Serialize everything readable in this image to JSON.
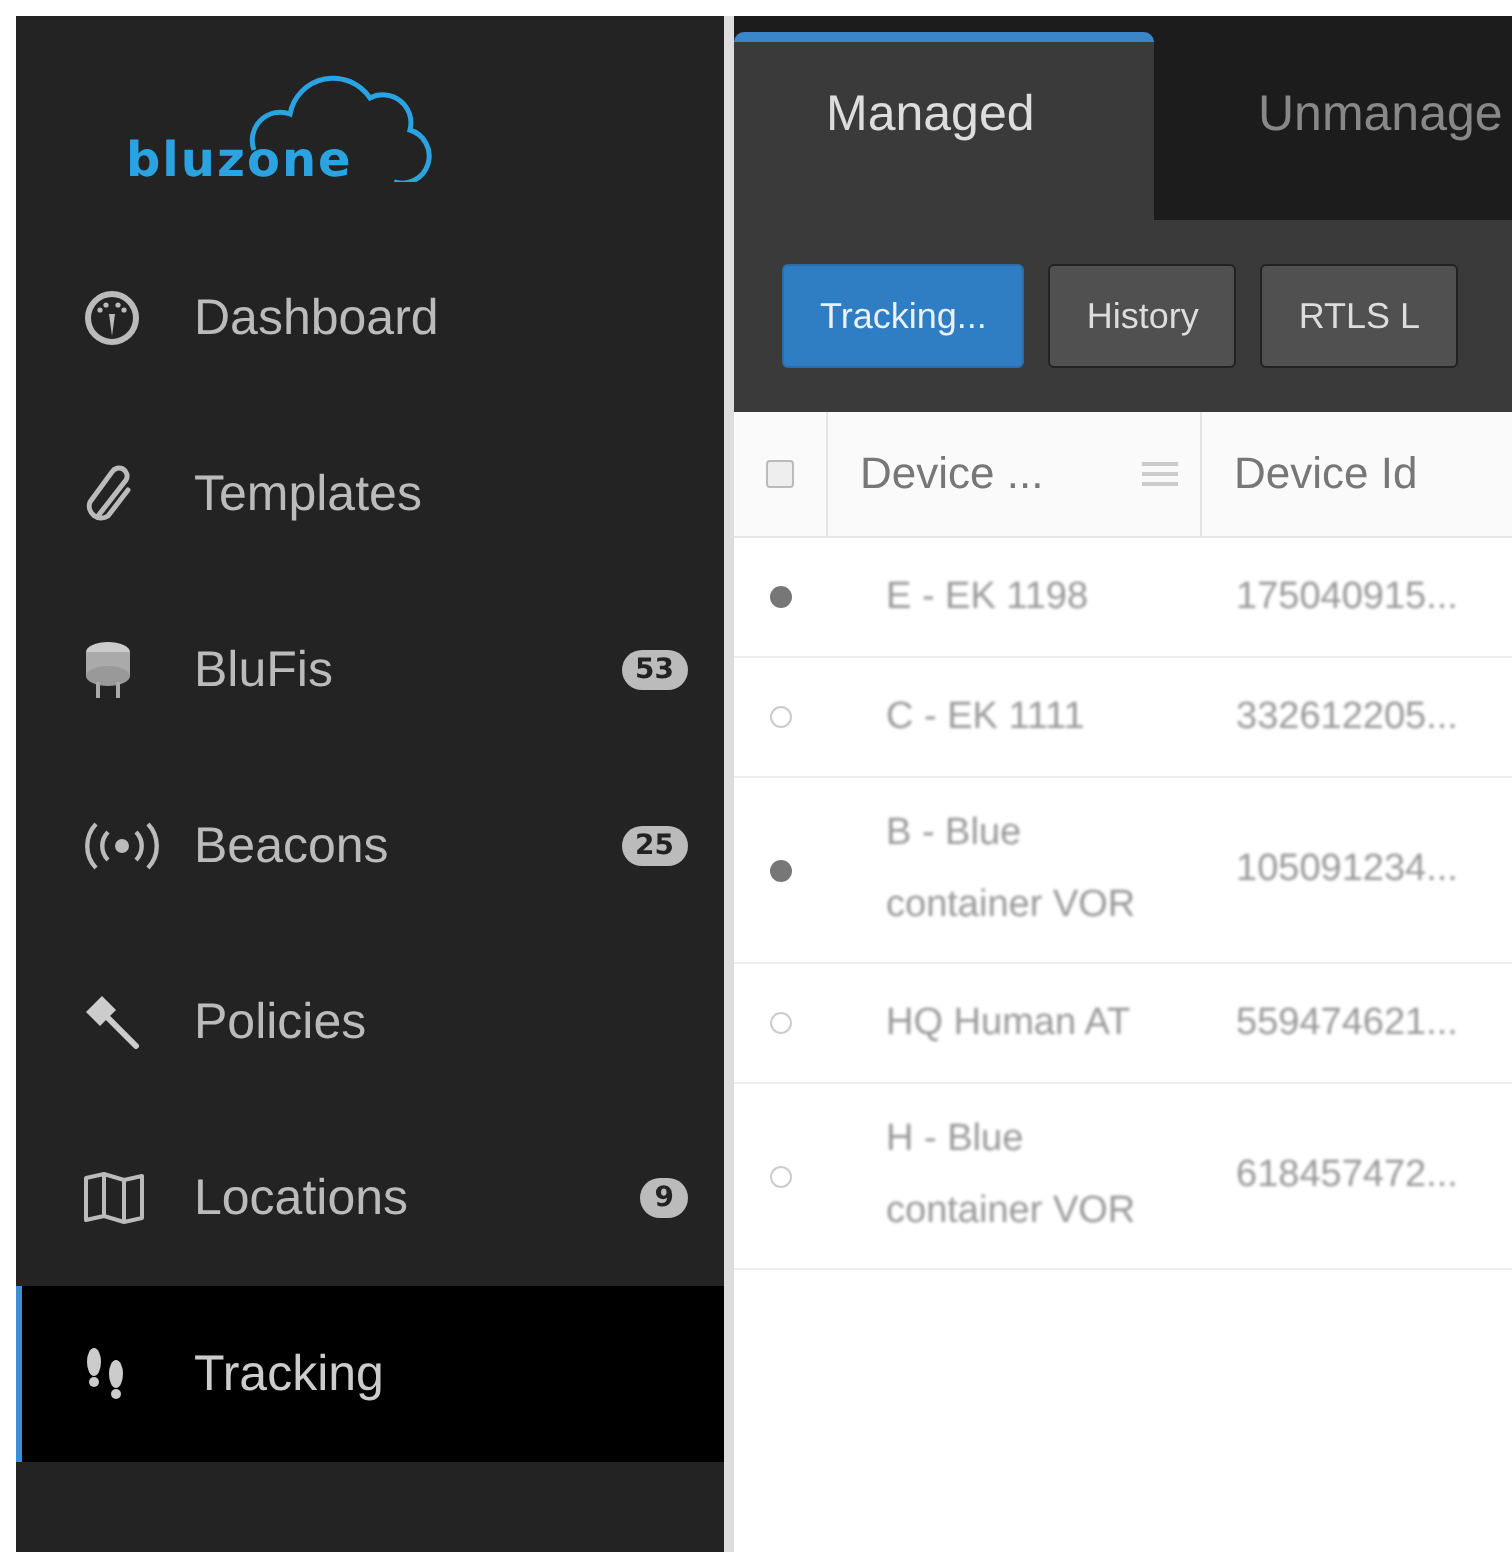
{
  "logo": {
    "text": "bluzone"
  },
  "sidebar": {
    "items": [
      {
        "label": "Dashboard",
        "selected": false
      },
      {
        "label": "Templates",
        "selected": false
      },
      {
        "label": "BluFis",
        "badge": "53",
        "selected": false
      },
      {
        "label": "Beacons",
        "badge": "25",
        "selected": false
      },
      {
        "label": "Policies",
        "selected": false
      },
      {
        "label": "Locations",
        "badge": "9",
        "selected": false
      },
      {
        "label": "Tracking",
        "selected": true
      }
    ]
  },
  "tabs": [
    {
      "label": "Managed",
      "selected": true
    },
    {
      "label": "Unmanage",
      "selected": false
    }
  ],
  "toolbar": [
    {
      "label": "Tracking...",
      "kind": "primary"
    },
    {
      "label": "History",
      "kind": "default"
    },
    {
      "label": "RTLS L",
      "kind": "default"
    }
  ],
  "table": {
    "select_all": {
      "checked": false
    },
    "columns": [
      "Device ...",
      "Device Id"
    ],
    "rows": [
      {
        "selected": true,
        "cells": [
          "E - EK 1198",
          "175040915..."
        ]
      },
      {
        "selected": false,
        "cells": [
          "C - EK 1111",
          "332612205..."
        ]
      },
      {
        "selected": true,
        "cells": [
          "B - Blue container VOR",
          "105091234..."
        ]
      },
      {
        "selected": false,
        "cells": [
          "HQ Human AT",
          "559474621..."
        ]
      },
      {
        "selected": false,
        "cells": [
          "H - Blue container VOR",
          "618457472..."
        ]
      }
    ]
  }
}
